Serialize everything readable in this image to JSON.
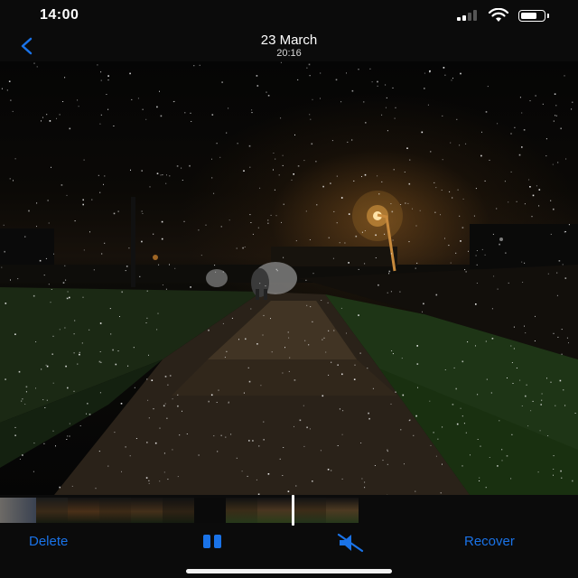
{
  "status_bar": {
    "time": "14:00",
    "icons": [
      "cellular-signal-icon",
      "wifi-icon",
      "battery-icon"
    ]
  },
  "nav": {
    "back_icon": "chevron-left-icon",
    "title": "23 March",
    "subtitle": "20:16"
  },
  "media": {
    "description_icon": "video-frame",
    "playhead_progress": 0.51
  },
  "toolbar": {
    "delete_label": "Delete",
    "pause_icon": "pause-icon",
    "mute_icon": "speaker-muted-icon",
    "recover_label": "Recover"
  },
  "colors": {
    "accent": "#1a73e8",
    "background": "#000000",
    "bar": "#0b0b0b"
  }
}
